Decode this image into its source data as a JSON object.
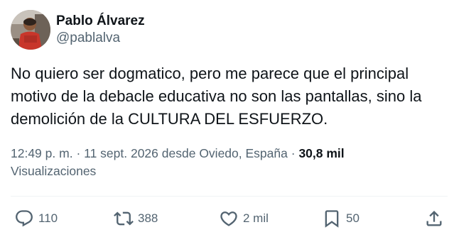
{
  "author": {
    "display_name": "Pablo Álvarez",
    "handle": "@pablalva"
  },
  "tweet": {
    "text": "No quiero ser dogmatico, pero me parece que el principal motivo de la debacle educativa no son las pantallas, sino la demolición de la CULTURA DEL ESFUERZO.",
    "time": "12:49 p. m.",
    "separator": "·",
    "date": "11 sept. 2026",
    "location": "desde Oviedo, España",
    "views_count": "30,8 mil",
    "views_label": "Visualizaciones"
  },
  "actions": {
    "replies": "110",
    "reposts": "388",
    "likes": "2 mil",
    "bookmarks": "50"
  },
  "icons": {
    "reply": "reply-icon",
    "repost": "repost-icon",
    "like": "heart-icon",
    "bookmark": "bookmark-icon",
    "share": "share-icon"
  },
  "colors": {
    "text_primary": "#0f1419",
    "text_secondary": "#536471",
    "divider": "#eff3f4"
  }
}
